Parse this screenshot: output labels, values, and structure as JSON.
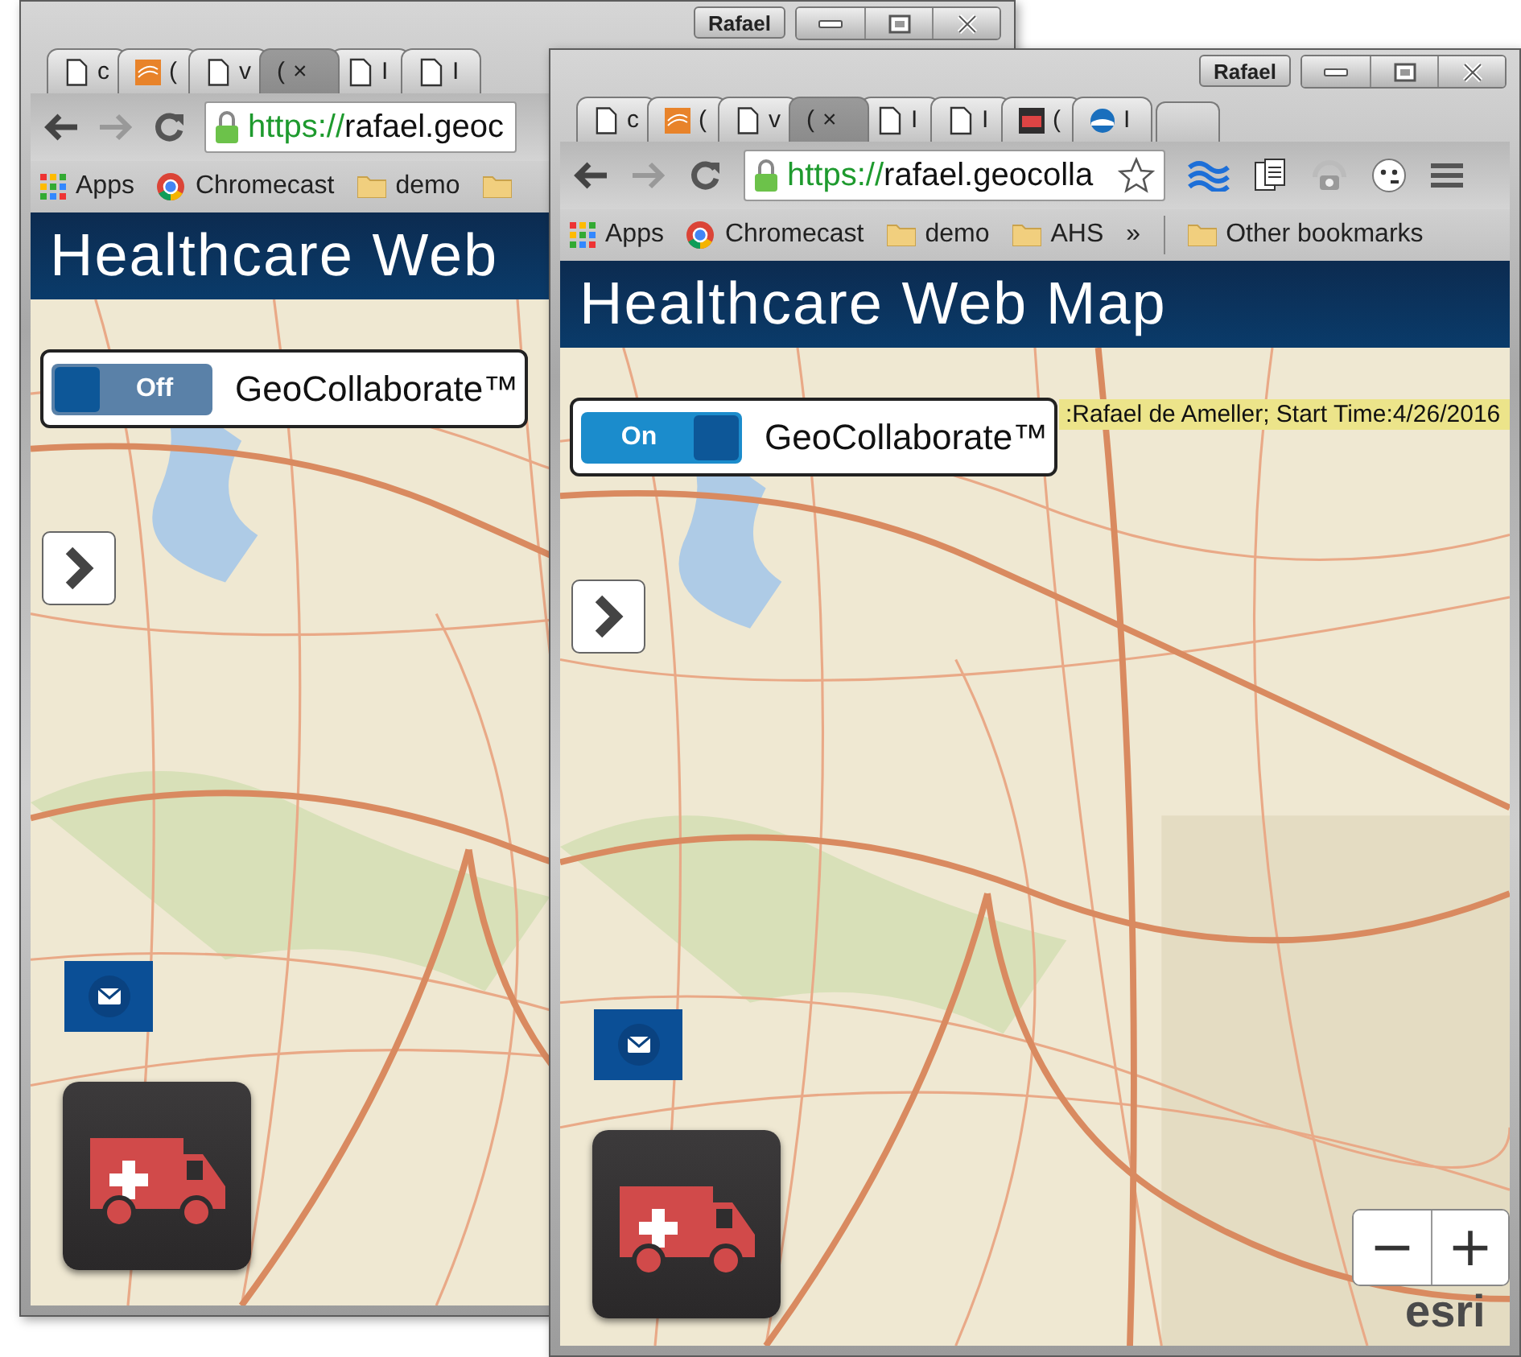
{
  "windows": [
    {
      "profile": "Rafael",
      "extensions_visible": false,
      "tabs": [
        {
          "kind": "page",
          "title": "c",
          "selected": false
        },
        {
          "kind": "geocollaborate",
          "title": "(",
          "selected": false
        },
        {
          "kind": "page",
          "title": "v",
          "selected": false
        },
        {
          "kind": "none",
          "title": "(",
          "close": "×",
          "selected": true
        },
        {
          "kind": "page",
          "title": "I",
          "selected": false
        },
        {
          "kind": "page",
          "title": "I",
          "selected": false
        }
      ],
      "url_scheme": "https://",
      "url_rest": "rafael.geoc",
      "bookmarks": [
        {
          "kind": "apps",
          "label": "Apps"
        },
        {
          "kind": "chrome",
          "label": "Chromecast"
        },
        {
          "kind": "folder",
          "label": "demo"
        },
        {
          "kind": "folder"
        }
      ],
      "app": {
        "title": "Healthcare Web",
        "toggle": {
          "label": "Off",
          "on": false
        },
        "brand": "GeoCollaborate™"
      }
    },
    {
      "profile": "Rafael",
      "extensions_visible": true,
      "tabs": [
        {
          "kind": "page",
          "title": "c",
          "selected": false
        },
        {
          "kind": "geocollaborate",
          "title": "(",
          "selected": false
        },
        {
          "kind": "page",
          "title": "v",
          "selected": false
        },
        {
          "kind": "none",
          "title": "(",
          "close": "×",
          "selected": true
        },
        {
          "kind": "page",
          "title": "I",
          "selected": false
        },
        {
          "kind": "page",
          "title": "I",
          "selected": false
        },
        {
          "kind": "ambulance",
          "title": "(",
          "selected": false
        },
        {
          "kind": "noaa",
          "title": "I",
          "selected": false
        }
      ],
      "new_tab_button": true,
      "url_scheme": "https://",
      "url_rest": "rafael.geocolla",
      "bookmarks": [
        {
          "kind": "apps",
          "label": "Apps"
        },
        {
          "kind": "chrome",
          "label": "Chromecast"
        },
        {
          "kind": "folder",
          "label": "demo"
        },
        {
          "kind": "folder",
          "label": "AHS"
        },
        {
          "kind": "more",
          "label": "»"
        },
        {
          "kind": "folder",
          "label": "Other bookmarks"
        }
      ],
      "app": {
        "title": "Healthcare Web Map",
        "toggle": {
          "label": "On",
          "on": true
        },
        "brand": "GeoCollaborate™",
        "session_banner": ":Rafael de Ameller; Start Time:4/26/2016",
        "zoom": [
          "−",
          "+"
        ],
        "attribution": "esri"
      }
    }
  ]
}
